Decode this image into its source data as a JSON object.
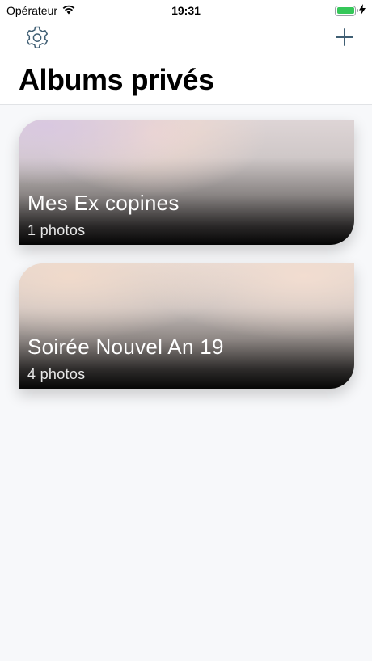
{
  "status_bar": {
    "carrier": "Opérateur",
    "time": "19:31",
    "battery_level": 1.0
  },
  "header": {
    "title": "Albums privés",
    "settings_icon": "gear-icon",
    "add_icon": "plus-icon"
  },
  "albums": [
    {
      "title": "Mes Ex copines",
      "count_label": "1 photos"
    },
    {
      "title": "Soirée Nouvel An 19",
      "count_label": "4 photos"
    }
  ],
  "colors": {
    "accent": "#3f5e73",
    "battery": "#35c759",
    "background": "#f7f8fa"
  }
}
